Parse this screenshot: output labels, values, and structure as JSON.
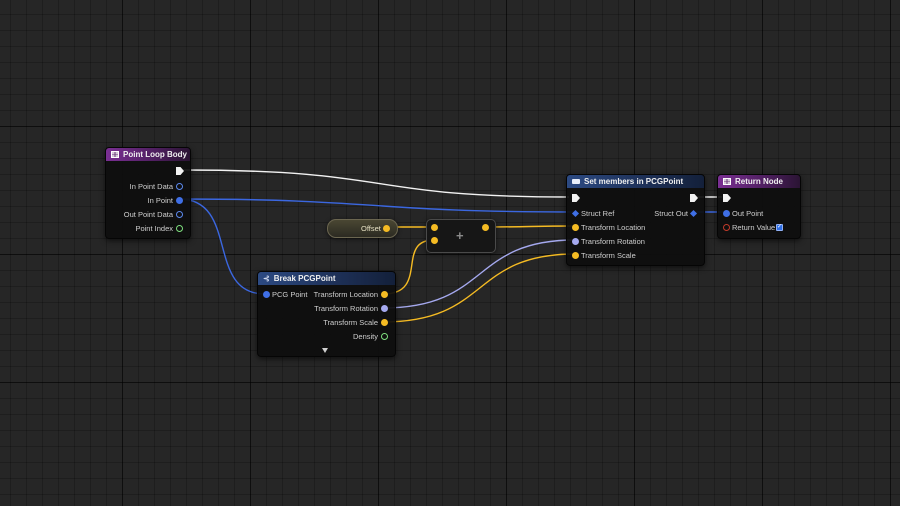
{
  "nodes": {
    "point_loop_body": {
      "title": "Point Loop Body",
      "pins": {
        "in_point_data": "In Point Data",
        "in_point": "In Point",
        "out_point_data": "Out Point Data",
        "point_index": "Point Index"
      }
    },
    "break_pcg_point": {
      "title": "Break PCGPoint",
      "inputs": {
        "pcg_point": "PCG Point"
      },
      "outputs": {
        "transform_location": "Transform Location",
        "transform_rotation": "Transform Rotation",
        "transform_scale": "Transform Scale",
        "density": "Density"
      }
    },
    "offset": {
      "label": "Offset"
    },
    "add": {
      "symbol": "+"
    },
    "set_members": {
      "title": "Set members in PCGPoint",
      "inputs": {
        "struct_ref": "Struct Ref",
        "transform_location": "Transform Location",
        "transform_rotation": "Transform Rotation",
        "transform_scale": "Transform Scale"
      },
      "outputs": {
        "struct_out": "Struct Out"
      }
    },
    "return_node": {
      "title": "Return Node",
      "pins": {
        "out_point": "Out Point",
        "return_value": "Return Value"
      },
      "return_value_checked": true
    }
  },
  "colors": {
    "exec_wire": "#ffffff",
    "struct_wire": "#3b67e0",
    "vector_wire": "#f5bb23",
    "rotator_wire": "#a5a9ef",
    "float_pin": "#7fe07f",
    "bool_pin": "#c23a2a",
    "function_header": "#7a2f93",
    "break_header": "#2c4a83"
  }
}
